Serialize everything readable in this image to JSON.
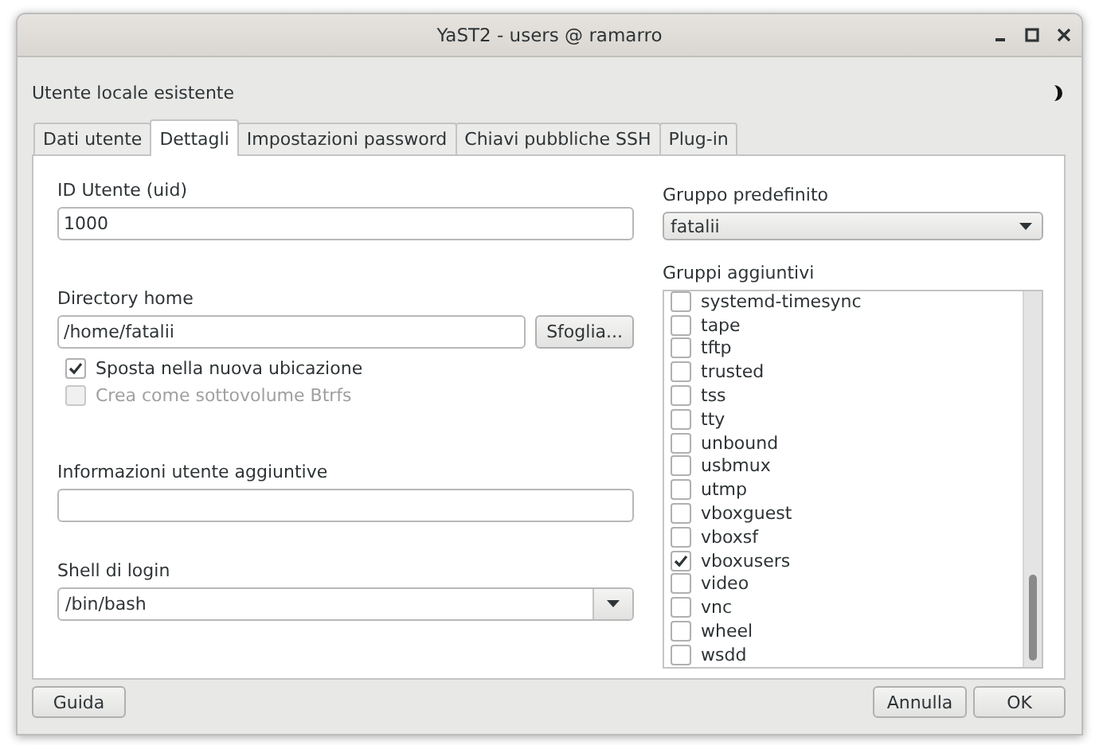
{
  "window": {
    "title": "YaST2 - users @ ramarro"
  },
  "heading": "Utente locale esistente",
  "tabs": [
    {
      "label": "Dati utente",
      "selected": false
    },
    {
      "label": "Dettagli",
      "selected": true
    },
    {
      "label": "Impostazioni password",
      "selected": false
    },
    {
      "label": "Chiavi pubbliche SSH",
      "selected": false
    },
    {
      "label": "Plug-in",
      "selected": false
    }
  ],
  "details": {
    "uid": {
      "label": "ID Utente (uid)",
      "value": "1000"
    },
    "home": {
      "label": "Directory home",
      "value": "/home/fatalii",
      "browse_button": "Sfoglia...",
      "options": [
        {
          "label": "Sposta nella nuova ubicazione",
          "checked": true,
          "disabled": false
        },
        {
          "label": "Crea come sottovolume Btrfs",
          "checked": false,
          "disabled": true
        }
      ]
    },
    "additional_info": {
      "label": "Informazioni utente aggiuntive"
    },
    "login_shell": {
      "label": "Shell di login",
      "value": "/bin/bash"
    },
    "default_group": {
      "label": "Gruppo predefinito",
      "value": "fatalii"
    },
    "additional_groups": {
      "label": "Gruppi aggiuntivi",
      "items": [
        {
          "name": "systemd-timesync",
          "checked": false
        },
        {
          "name": "tape",
          "checked": false
        },
        {
          "name": "tftp",
          "checked": false
        },
        {
          "name": "trusted",
          "checked": false
        },
        {
          "name": "tss",
          "checked": false
        },
        {
          "name": "tty",
          "checked": false
        },
        {
          "name": "unbound",
          "checked": false
        },
        {
          "name": "usbmux",
          "checked": false
        },
        {
          "name": "utmp",
          "checked": false
        },
        {
          "name": "vboxguest",
          "checked": false
        },
        {
          "name": "vboxsf",
          "checked": false
        },
        {
          "name": "vboxusers",
          "checked": true
        },
        {
          "name": "video",
          "checked": false
        },
        {
          "name": "vnc",
          "checked": false
        },
        {
          "name": "wheel",
          "checked": false
        },
        {
          "name": "wsdd",
          "checked": false
        }
      ]
    }
  },
  "help_button": "Guida",
  "buttons": [
    "Annulla",
    "OK"
  ]
}
